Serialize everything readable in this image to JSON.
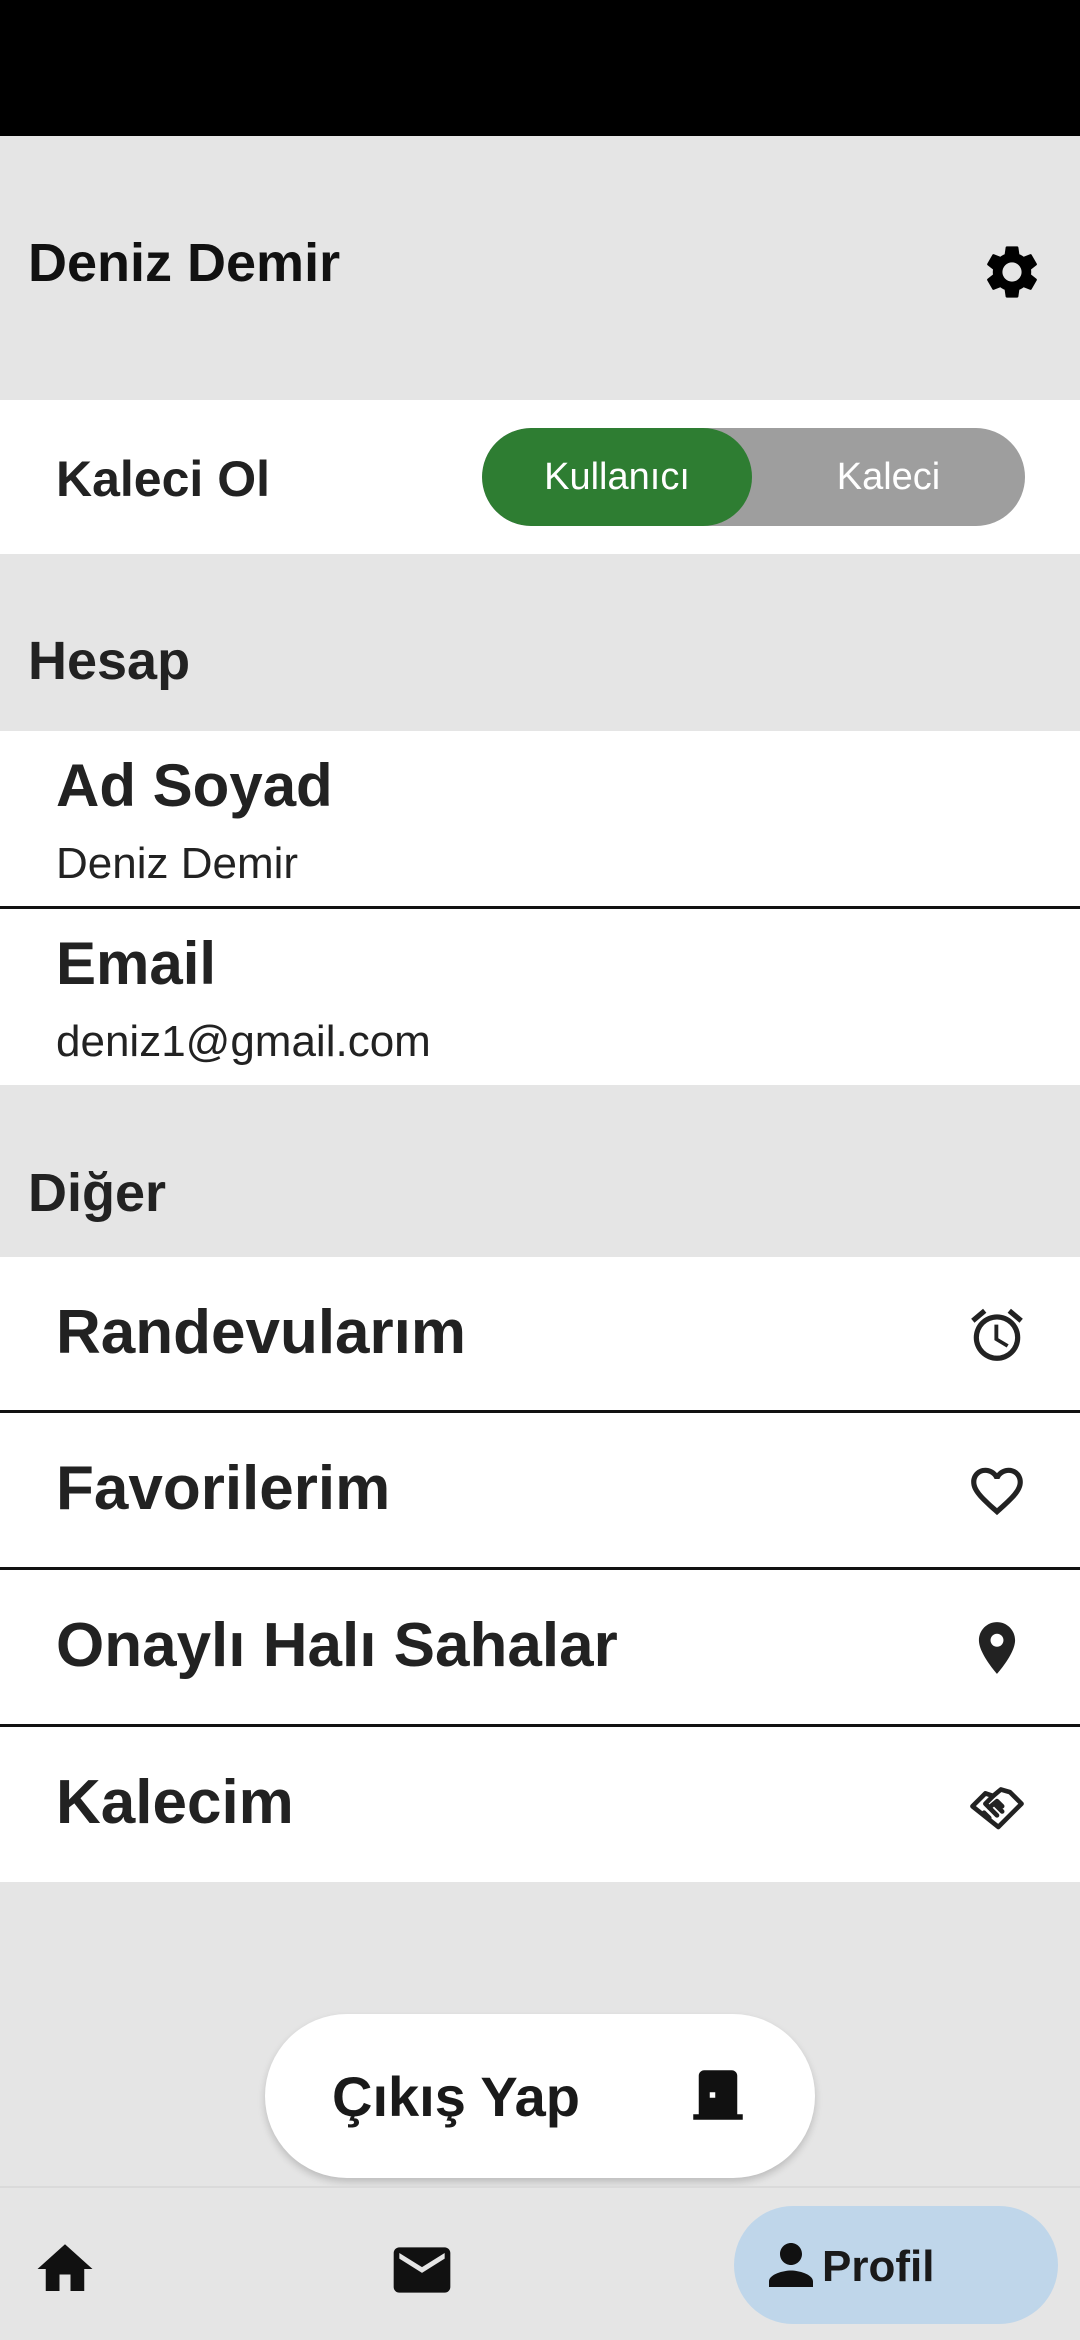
{
  "header": {
    "title": "Deniz Demir",
    "settings_icon": "gear-icon"
  },
  "role_toggle": {
    "label": "Kaleci Ol",
    "options": [
      "Kullanıcı",
      "Kaleci"
    ],
    "selected": "Kullanıcı",
    "accent": "#2e7d32"
  },
  "account": {
    "section_title": "Hesap",
    "fields": [
      {
        "label": "Ad Soyad",
        "value": "Deniz Demir"
      },
      {
        "label": "Email",
        "value": "deniz1@gmail.com"
      }
    ]
  },
  "other": {
    "section_title": "Diğer",
    "items": [
      {
        "label": "Randevularım",
        "icon": "alarm-icon"
      },
      {
        "label": "Favorilerim",
        "icon": "heart-icon"
      },
      {
        "label": "Onaylı Halı Sahalar",
        "icon": "location-pin-icon"
      },
      {
        "label": "Kalecim",
        "icon": "handshake-icon"
      }
    ]
  },
  "logout": {
    "label": "Çıkış Yap",
    "icon": "door-icon"
  },
  "bottom_nav": {
    "items": [
      {
        "icon": "home-icon"
      },
      {
        "icon": "mail-icon"
      },
      {
        "icon": "person-icon",
        "label": "Profil",
        "active": true
      }
    ]
  }
}
